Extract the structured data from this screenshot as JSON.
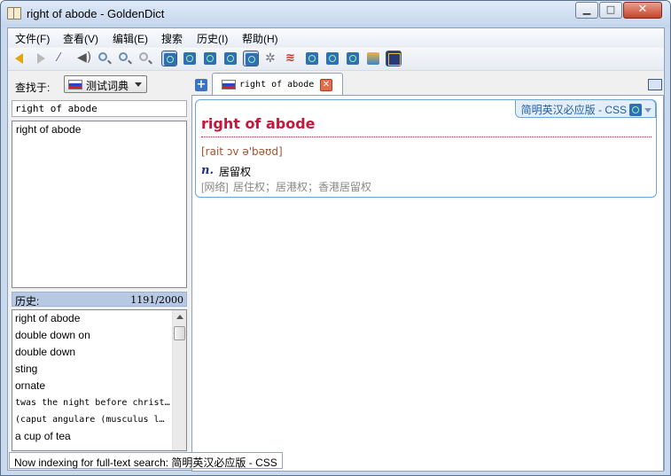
{
  "window": {
    "title": "right of abode - GoldenDict"
  },
  "menu": {
    "items": [
      "文件(F)",
      "查看(V)",
      "编辑(E)",
      "搜索",
      "历史(I)",
      "帮助(H)"
    ]
  },
  "toolbar": {
    "icons": [
      "back-icon",
      "forward-icon",
      "wand-icon",
      "speaker-icon",
      "zoom-in-icon",
      "zoom-out-icon",
      "zoom-reset-icon",
      "dict-icon",
      "dict-icon",
      "dict-icon",
      "dict-icon",
      "dict-icon",
      "settings-icon",
      "waves-icon",
      "dict-icon",
      "dict-icon",
      "dict-icon",
      "image-icon",
      "dict-selected-icon"
    ]
  },
  "left": {
    "find_label": "查找于:",
    "group": "测试词典",
    "search_value": "right of abode",
    "word_list": [
      "right of abode"
    ],
    "history_label": "历史:",
    "history_count": "1191/2000",
    "history": [
      {
        "text": "right of abode",
        "mono": false
      },
      {
        "text": "double down on",
        "mono": false
      },
      {
        "text": "double down",
        "mono": false
      },
      {
        "text": "sting",
        "mono": false
      },
      {
        "text": "ornate",
        "mono": false
      },
      {
        "text": "twas the night before christ…",
        "mono": true
      },
      {
        "text": "(caput angulare (musculus l…",
        "mono": true
      },
      {
        "text": "a cup of tea",
        "mono": false
      }
    ]
  },
  "tab": {
    "label": "right of abode",
    "close": "✕"
  },
  "article": {
    "dict_name": "简明英汉必应版 - CSS",
    "headword": "right of abode",
    "phonetic": "[rait ɔv ə'bəʊd]",
    "pos": "n.",
    "definition": "居留权",
    "web_tag": "[网络]",
    "web_defs": "居住权；居港权；香港居留权"
  },
  "status": {
    "text": "Now indexing for full-text search: 简明英汉必应版 - CSS"
  },
  "colors": {
    "headword": "#c4173b",
    "dict_title": "#1f5ea8",
    "history_header": "#b7c9e2"
  }
}
